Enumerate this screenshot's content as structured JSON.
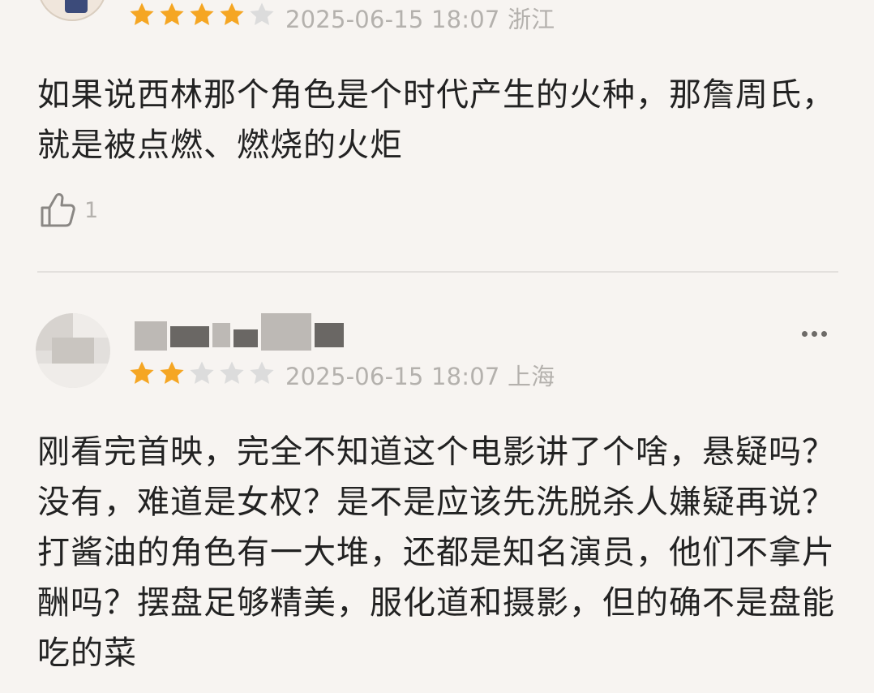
{
  "comments": [
    {
      "rating": 4,
      "max_rating": 5,
      "timestamp": "2025-06-15 18:07",
      "location": "浙江",
      "text": "如果说西林那个角色是个时代产生的火种，那詹周氏，就是被点燃、燃烧的火炬",
      "like_count": "1"
    },
    {
      "rating": 2,
      "max_rating": 5,
      "timestamp": "2025-06-15 18:07",
      "location": "上海",
      "text": "刚看完首映，完全不知道这个电影讲了个啥，悬疑吗？没有，难道是女权？是不是应该先洗脱杀人嫌疑再说？打酱油的角色有一大堆，还都是知名演员，他们不拿片酬吗？摆盘足够精美，服化道和摄影，但的确不是盘能吃的菜"
    }
  ],
  "colors": {
    "star_on": "#f5a623",
    "star_off": "#dcdcdc",
    "meta_text": "#b4b1ad",
    "background": "#f7f4f1"
  },
  "icons": {
    "like": "thumbs-up-icon",
    "more": "more-horizontal-icon",
    "star": "star-icon"
  }
}
